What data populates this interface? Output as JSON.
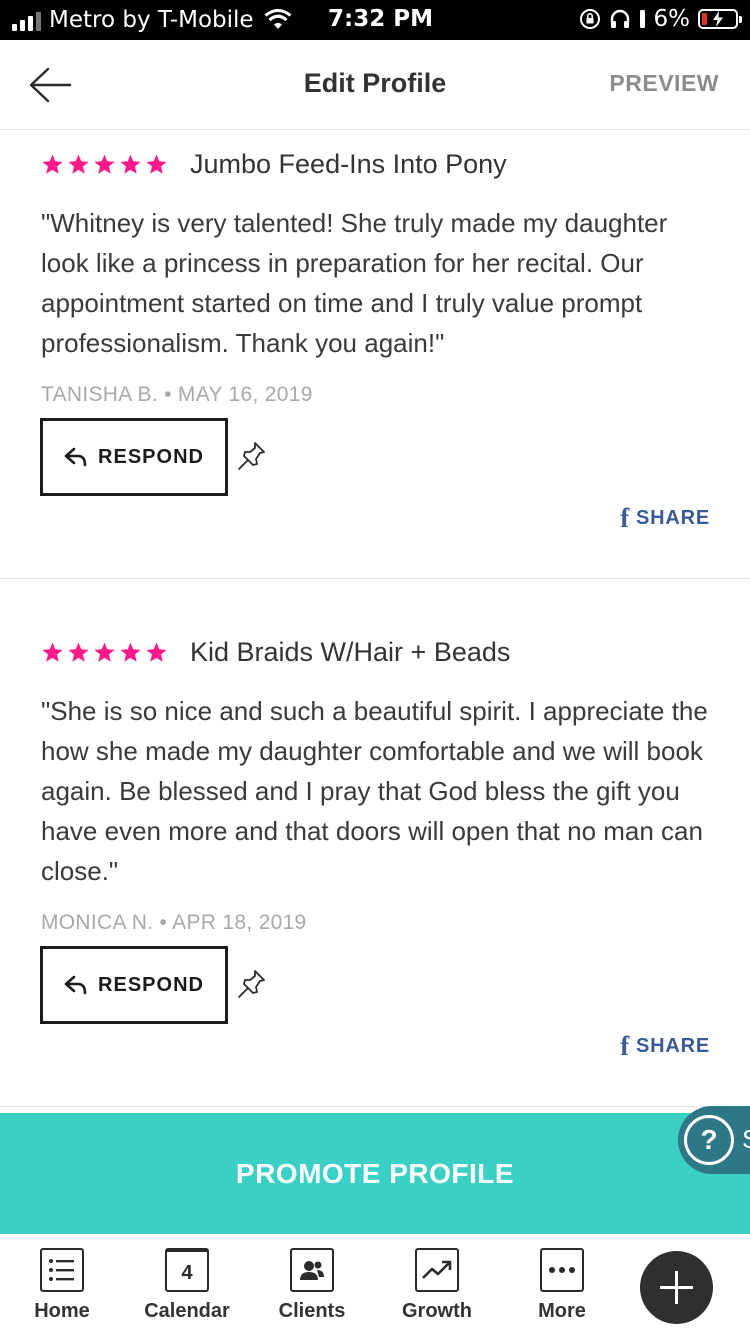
{
  "status_bar": {
    "carrier": "Metro by T-Mobile",
    "time": "7:32 PM",
    "battery": "6%",
    "icons": [
      "signal-icon",
      "wifi-icon",
      "orientation-lock-icon",
      "headphones-icon",
      "battery-charging-icon"
    ]
  },
  "header": {
    "title": "Edit Profile",
    "back_icon": "arrow-left-icon",
    "preview_label": "PREVIEW"
  },
  "reviews": [
    {
      "rating": 5,
      "service": "Jumbo Feed-Ins Into Pony",
      "text": "\"Whitney is very talented! She truly made my daughter look like a princess in preparation for her recital. Our appointment started on time and I truly value prompt professionalism.  Thank you again!\"",
      "author": "TANISHA B.",
      "date": "MAY 16, 2019",
      "respond_label": "RESPOND",
      "share_label": "SHARE"
    },
    {
      "rating": 5,
      "service": "Kid Braids W/Hair + Beads",
      "text": "\"She is so nice and such a beautiful spirit. I appreciate the how she made my daughter comfortable and we will book again. Be blessed and I pray that God bless the gift you have even more and that doors will open that no man can close.\"",
      "author": "MONICA N.",
      "date": "APR 18, 2019",
      "respond_label": "RESPOND",
      "share_label": "SHARE"
    }
  ],
  "meta_separator": "•",
  "star_color": "#ff1a8c",
  "promote": {
    "label": "PROMOTE PROFILE",
    "color": "#3ad0c6"
  },
  "help": {
    "symbol": "?",
    "label_fragment": "S"
  },
  "tabbar": {
    "tabs": [
      {
        "label": "Home",
        "icon": "list-icon"
      },
      {
        "label": "Calendar",
        "icon": "calendar-icon",
        "icon_text": "4"
      },
      {
        "label": "Clients",
        "icon": "clients-icon"
      },
      {
        "label": "Growth",
        "icon": "growth-chart-icon"
      },
      {
        "label": "More",
        "icon": "more-dots-icon"
      }
    ],
    "add_icon": "plus-icon"
  }
}
